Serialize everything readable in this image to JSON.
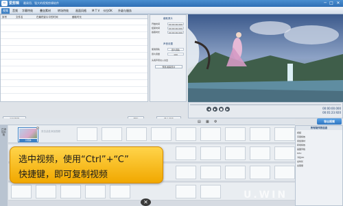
{
  "window": {
    "title": "爱剪辑",
    "subtitle": "最易用、强大的视频剪辑软件",
    "controls": [
      "─",
      "□",
      "✕"
    ]
  },
  "menu": [
    "视频",
    "音频",
    "字幕特效",
    "叠加素材",
    "转场特效",
    "画面风格",
    "M T V",
    "卡拉OK",
    "升级与服务"
  ],
  "clip_list": {
    "columns": [
      "序号",
      "文件名",
      "在最终影片中的时间",
      "截取时长"
    ]
  },
  "buttons": {
    "add_video": "添加视频",
    "delete": "删除",
    "confirm": "确认修改"
  },
  "settings": {
    "section1": "截取原片",
    "start_label": "开始时间",
    "start_value": "00:00:00.000",
    "end_label": "结束时间",
    "end_value": "00:00:00.000",
    "dur_label": "截取时长",
    "dur_value": "00:00:00.000",
    "preview_btn": "预览/截取原片",
    "section2": "声音设置",
    "track_label": "使用音轨",
    "track_value": "原片音轨",
    "vol_label": "原片音量",
    "vol_value": "100",
    "check_label": "头尾声音淡入淡出"
  },
  "preview": {
    "time_current": "00:00:00.000",
    "time_total": "00:01:23.920",
    "progress": 0.0
  },
  "export": {
    "label": "导出视频"
  },
  "timeline": {
    "side_label": "已添加片段",
    "clip_label": "大雨淋",
    "add_hint": "双击此处添加视频"
  },
  "callout": {
    "line1": "选中视频，使用“Ctrl”+“C”",
    "line2": "快捷键，即可复制视频"
  },
  "props": {
    "title": "所有制作的信息",
    "lines": [
      "视频",
      "字幕特效",
      "叠加素材",
      "转场特效",
      "画面风格",
      "MTV",
      "卡拉OK",
      "总时长",
      "总容量"
    ]
  },
  "watermark": "U.WIN"
}
